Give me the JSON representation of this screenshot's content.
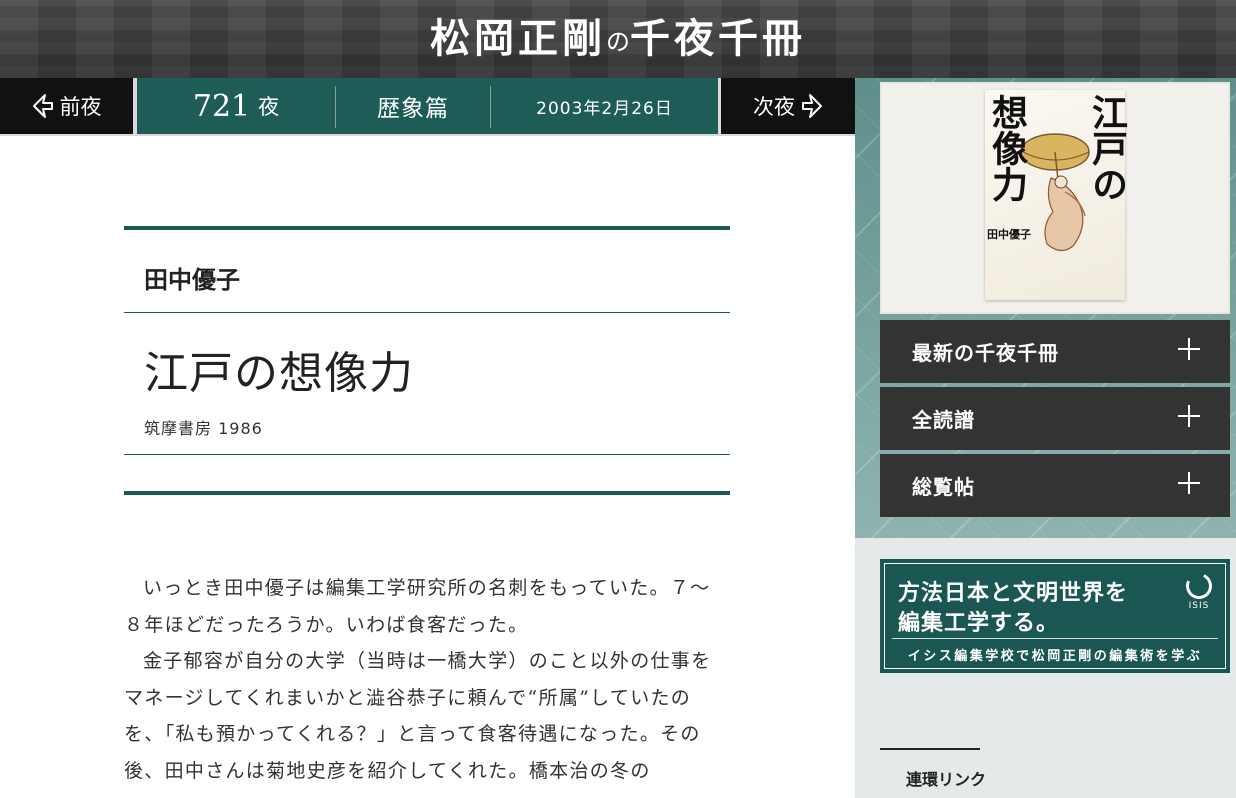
{
  "header": {
    "title_a": "松岡正剛",
    "title_no": "の",
    "title_b": "千夜千冊"
  },
  "nav": {
    "prev_label": "前夜",
    "night_number": "721",
    "night_label": "夜",
    "genre": "歴象篇",
    "date": "2003年2月26日",
    "next_label": "次夜"
  },
  "article": {
    "author": "田中優子",
    "title": "江戸の想像力",
    "publisher": "筑摩書房 1986",
    "paragraphs": [
      "いっとき田中優子は編集工学研究所の名刺をもっていた。７〜８年ほどだったろうか。いわば食客だった。",
      "金子郁容が自分の大学（当時は一橋大学）のこと以外の仕事をマネージしてくれまいかと澁谷恭子に頼んで“所属”していたのを、「私も預かってくれる？」と言って食客待遇になった。その後、田中さんは菊地史彦を紹介してくれた。橋本治の冬の"
    ]
  },
  "sidebar": {
    "cover": {
      "title_right": "江戸の",
      "title_left": "想像力",
      "author": "田中優子"
    },
    "menu": [
      {
        "label": "最新の千夜千冊"
      },
      {
        "label": "全読譜"
      },
      {
        "label": "総覧帖"
      }
    ],
    "banner": {
      "line1": "方法日本と文明世界を",
      "line2": "編集工学する。",
      "sub": "イシス編集学校で松岡正剛の編集術を学ぶ",
      "logo_text": "ISIS"
    },
    "links_title": "連環リンク"
  },
  "colors": {
    "accent_green": "#1d5c57",
    "nav_black": "#111111",
    "menu_dark": "#333333"
  }
}
